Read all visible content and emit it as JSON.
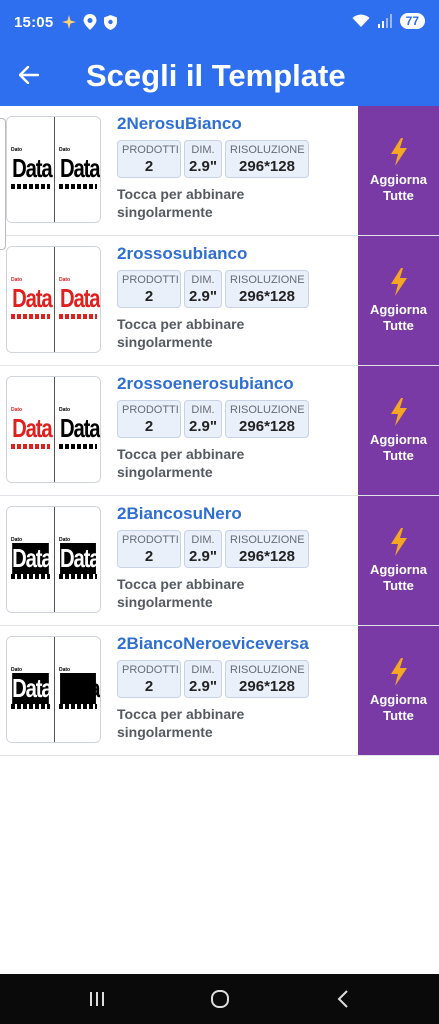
{
  "status": {
    "time": "15:05",
    "battery": "77"
  },
  "header": {
    "title": "Scegli il Template"
  },
  "labels": {
    "products": "PRODOTTI",
    "dim": "DIM.",
    "resolution": "RISOLUZIONE",
    "hint": "Tocca per abbinare singolarmente",
    "update_line1": "Aggiorna",
    "update_line2": "Tutte"
  },
  "colors": {
    "accent": "#2e6ff0",
    "button": "#7a3aa5",
    "link": "#2f6fd1",
    "bolt": "#f5a623"
  },
  "templates": [
    {
      "name": "2NerosuBianco",
      "products": "2",
      "dim": "2.9\"",
      "resolution": "296*128",
      "left_color": "#000000",
      "right_color": "#000000",
      "inverted": false,
      "thumb_word": "Data",
      "thumb_top": "Dato"
    },
    {
      "name": "2rossosubianco",
      "products": "2",
      "dim": "2.9\"",
      "resolution": "296*128",
      "left_color": "#e0201e",
      "right_color": "#e0201e",
      "inverted": false,
      "thumb_word": "Data",
      "thumb_top": "Dato"
    },
    {
      "name": "2rossoenerosubianco",
      "products": "2",
      "dim": "2.9\"",
      "resolution": "296*128",
      "left_color": "#e0201e",
      "right_color": "#000000",
      "inverted": false,
      "thumb_word": "Data",
      "thumb_top": "Dato"
    },
    {
      "name": "2BiancosuNero",
      "products": "2",
      "dim": "2.9\"",
      "resolution": "296*128",
      "left_color": "#ffffff",
      "right_color": "#ffffff",
      "inverted": true,
      "thumb_word": "Data",
      "thumb_top": "Dato"
    },
    {
      "name": "2BiancoNeroeviceversa",
      "products": "2",
      "dim": "2.9\"",
      "resolution": "296*128",
      "left_color": "#ffffff",
      "right_color": "#000000",
      "inverted": true,
      "thumb_word": "Data",
      "thumb_top": "Dato"
    }
  ],
  "icons": {
    "back": "arrow-left-icon",
    "bolt": "lightning-icon",
    "recents": "recents-icon",
    "home": "home-icon",
    "nav_back": "chevron-left-icon"
  }
}
